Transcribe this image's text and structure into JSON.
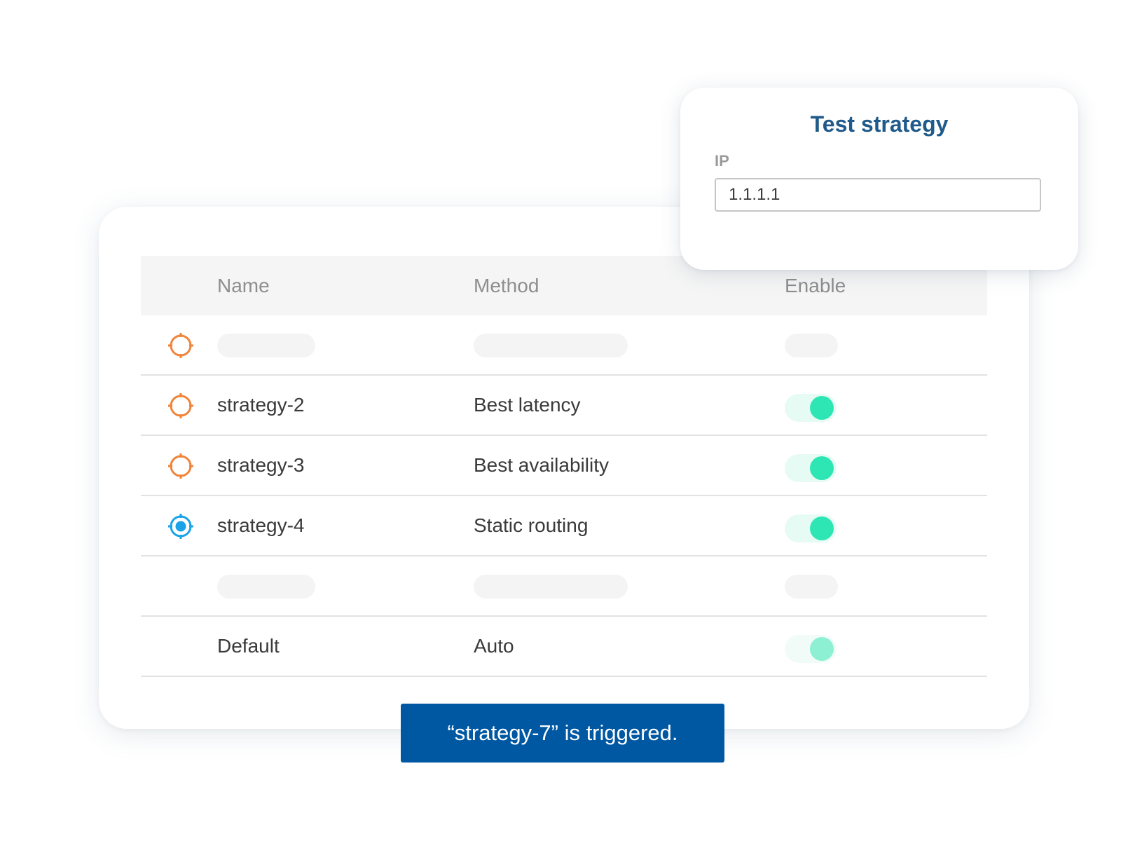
{
  "colors": {
    "accent": "#0058a3",
    "title": "#1f5a8a",
    "pending_icon": "#f0843a",
    "active_icon": "#1aa3e8",
    "toggle_knob": "#2ee6b3"
  },
  "table": {
    "headers": {
      "name": "Name",
      "method": "Method",
      "enable": "Enable"
    },
    "rows": [
      {
        "placeholder": true,
        "icon": "crosshair-icon",
        "icon_state": "pending"
      },
      {
        "name": "strategy-2",
        "method": "Best latency",
        "enabled": true,
        "icon": "crosshair-icon",
        "icon_state": "pending"
      },
      {
        "name": "strategy-3",
        "method": "Best availability",
        "enabled": true,
        "icon": "crosshair-icon",
        "icon_state": "pending"
      },
      {
        "name": "strategy-4",
        "method": "Static routing",
        "enabled": true,
        "icon": "crosshair-active-icon",
        "icon_state": "active"
      },
      {
        "placeholder": true
      },
      {
        "name": "Default",
        "method": "Auto",
        "enabled": true,
        "faded": true
      }
    ]
  },
  "popover": {
    "title": "Test strategy",
    "ip_label": "IP",
    "ip_value": "1.1.1.1"
  },
  "toast": {
    "message": "“strategy-7” is triggered."
  }
}
